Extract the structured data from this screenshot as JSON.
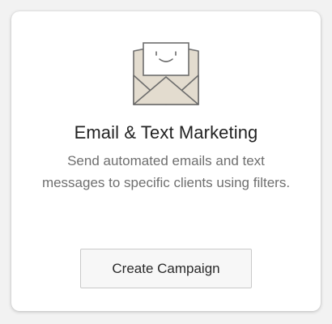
{
  "card": {
    "title": "Email & Text Marketing",
    "description": "Send automated emails and text messages to specific clients using filters.",
    "button_label": "Create Campaign",
    "illustration_icon": "envelope-with-smiley-letter-icon"
  },
  "colors": {
    "envelope_fill": "#e3dccf",
    "envelope_stroke": "#6d6d6d",
    "letter_fill": "#ffffff",
    "title_text": "#222222",
    "description_text": "#6f6f6f",
    "button_background": "#f7f7f7",
    "button_border": "#c9c9c9"
  }
}
